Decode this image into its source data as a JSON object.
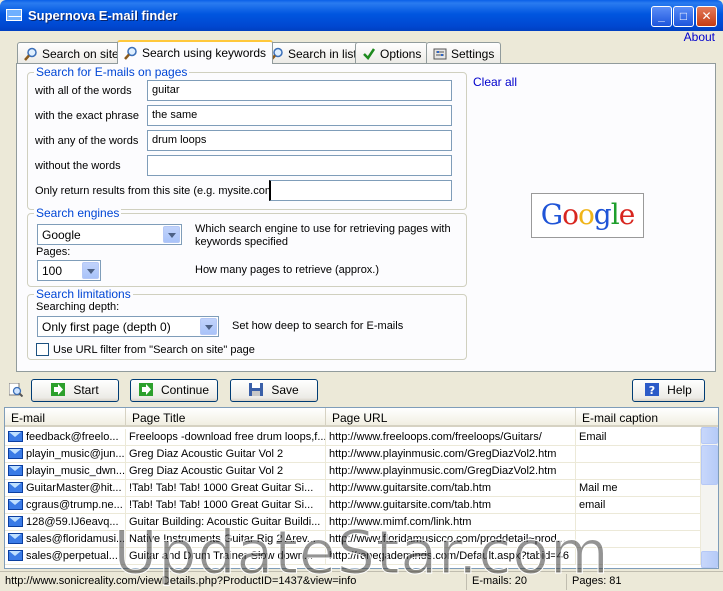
{
  "window": {
    "title": "Supernova E-mail finder",
    "about": "About"
  },
  "tabs": [
    {
      "label": "Search on site",
      "icon": "magnifier-icon"
    },
    {
      "label": "Search using keywords",
      "icon": "magnifier-icon"
    },
    {
      "label": "Search in list",
      "icon": "magnifier-icon"
    },
    {
      "label": "Options",
      "icon": "checkmark-icon"
    },
    {
      "label": "Settings",
      "icon": "settings-icon"
    }
  ],
  "pages_group": {
    "title": "Search for E-mails on pages",
    "all_words_label": "with all of the words",
    "all_words_value": "guitar",
    "exact_phrase_label": "with the exact phrase",
    "exact_phrase_value": "the same",
    "any_words_label": "with any of the words",
    "any_words_value": "drum loops",
    "without_words_label": "without the words",
    "without_words_value": "",
    "site_only_label": "Only return results from this site (e.g. mysite.com)",
    "site_only_value": ""
  },
  "clear_all": "Clear all",
  "engines_group": {
    "title": "Search engines",
    "engine_value": "Google",
    "engine_desc": "Which search engine to use for retrieving pages with keywords specified",
    "pages_label": "Pages:",
    "pages_value": "100",
    "pages_desc": "How many pages to retrieve (approx.)"
  },
  "limits_group": {
    "title": "Search limitations",
    "depth_label": "Searching depth:",
    "depth_value": "Only first page (depth 0)",
    "depth_desc": "Set how deep to search for E-mails",
    "url_filter_label": "Use URL filter from \"Search on site\" page"
  },
  "logo": {
    "letters": [
      "G",
      "o",
      "o",
      "g",
      "l",
      "e"
    ]
  },
  "buttons": {
    "start": "Start",
    "continue": "Continue",
    "save": "Save",
    "help": "Help"
  },
  "table": {
    "headers": [
      "E-mail",
      "Page Title",
      "Page URL",
      "E-mail caption"
    ],
    "rows": [
      [
        "feedback@freelo...",
        "Freeloops -download free drum loops,f...",
        "http://www.freeloops.com/freeloops/Guitars/",
        "Email"
      ],
      [
        "playin_music@jun...",
        "Greg Diaz Acoustic Guitar Vol 2",
        "http://www.playinmusic.com/GregDiazVol2.htm",
        ""
      ],
      [
        "playin_music_dwn...",
        "Greg Diaz Acoustic Guitar Vol 2",
        "http://www.playinmusic.com/GregDiazVol2.htm",
        ""
      ],
      [
        "GuitarMaster@hit...",
        "!Tab! Tab! Tab! 1000 Great Guitar Si...",
        "http://www.guitarsite.com/tab.htm",
        "Mail me"
      ],
      [
        "cgraus@trump.ne...",
        "!Tab! Tab! Tab! 1000 Great Guitar Si...",
        "http://www.guitarsite.com/tab.htm",
        "email"
      ],
      [
        "128@59.IJ6eavq...",
        "Guitar Building: Acoustic Guitar Buildi...",
        "http://www.mimf.com/link.htm",
        ""
      ],
      [
        "sales@floridamusi...",
        "Native Instruments Guitar Rig 2 Arev...",
        "http://www.floridamusicco.com/proddetail~prod...",
        ""
      ],
      [
        "sales@perpetual...",
        "Guitar and Drum Trainer Slow down...",
        "http://renegademinds.com/Default.aspx?tabid=46",
        ""
      ]
    ]
  },
  "status": {
    "url": "http://www.sonicreality.com/viewDetails.php?ProductID=1437&view=info",
    "emails": "E-mails: 20",
    "pages": "Pages: 81"
  },
  "watermark": "UpdateStar.com"
}
